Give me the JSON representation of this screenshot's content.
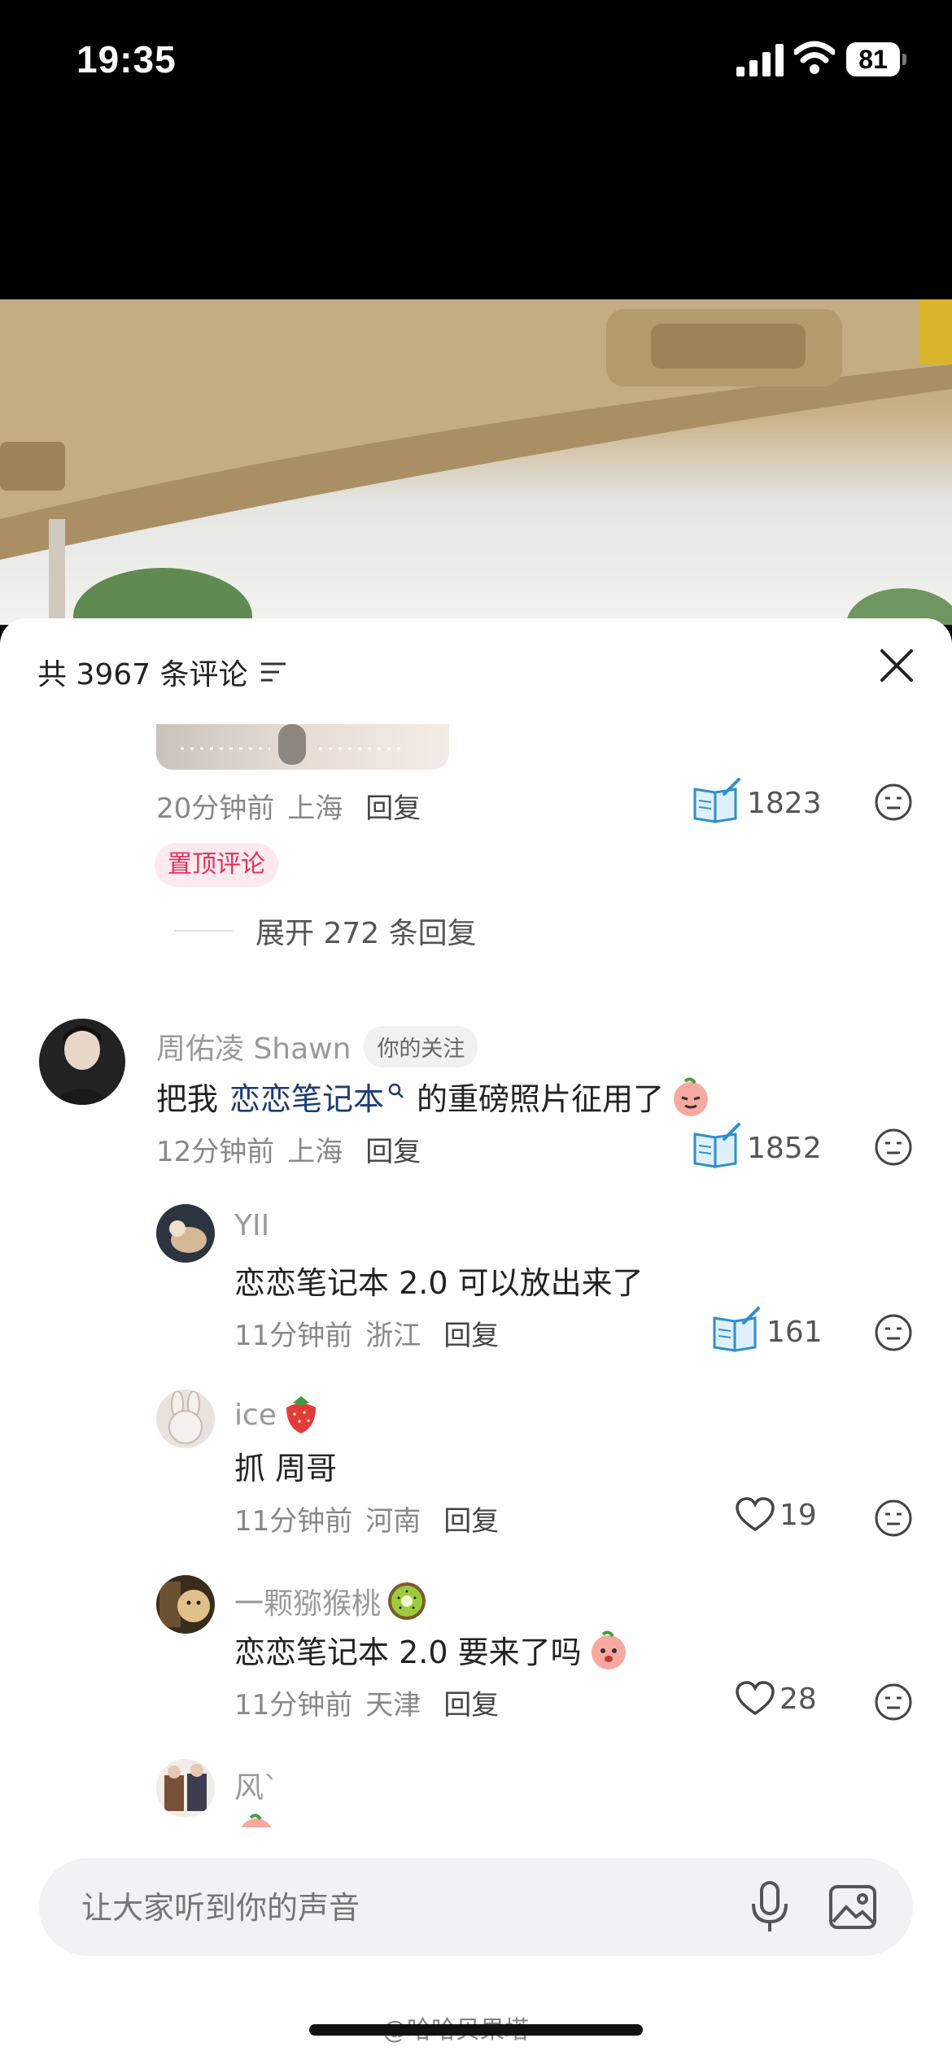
{
  "status_bar": {
    "time": "19:35",
    "battery": "81"
  },
  "header": {
    "title": "共 3967 条评论"
  },
  "pinned_comment": {
    "time": "20分钟前",
    "location": "上海",
    "reply_label": "回复",
    "likes": "1823",
    "badge": "置顶评论",
    "expand_label": "展开 272 条回复"
  },
  "comments": [
    {
      "name": "周佑凌 Shawn",
      "tag": "你的关注",
      "text_before": "把我",
      "link": "恋恋笔记本",
      "text_after": "的重磅照片征用了",
      "time": "12分钟前",
      "location": "上海",
      "reply_label": "回复",
      "likes": "1852"
    },
    {
      "name": "YII",
      "text": "恋恋笔记本 2.0 可以放出来了",
      "time": "11分钟前",
      "location": "浙江",
      "reply_label": "回复",
      "likes": "161"
    },
    {
      "name": "ice",
      "text": "抓 周哥",
      "time": "11分钟前",
      "location": "河南",
      "reply_label": "回复",
      "likes": "19"
    },
    {
      "name": "一颗猕猴桃",
      "text": "恋恋笔记本 2.0 要来了吗",
      "time": "11分钟前",
      "location": "天津",
      "reply_label": "回复",
      "likes": "28"
    },
    {
      "name": "风`"
    }
  ],
  "input": {
    "placeholder": "让大家听到你的声音"
  },
  "watermark": "@哈哈贝果塔"
}
